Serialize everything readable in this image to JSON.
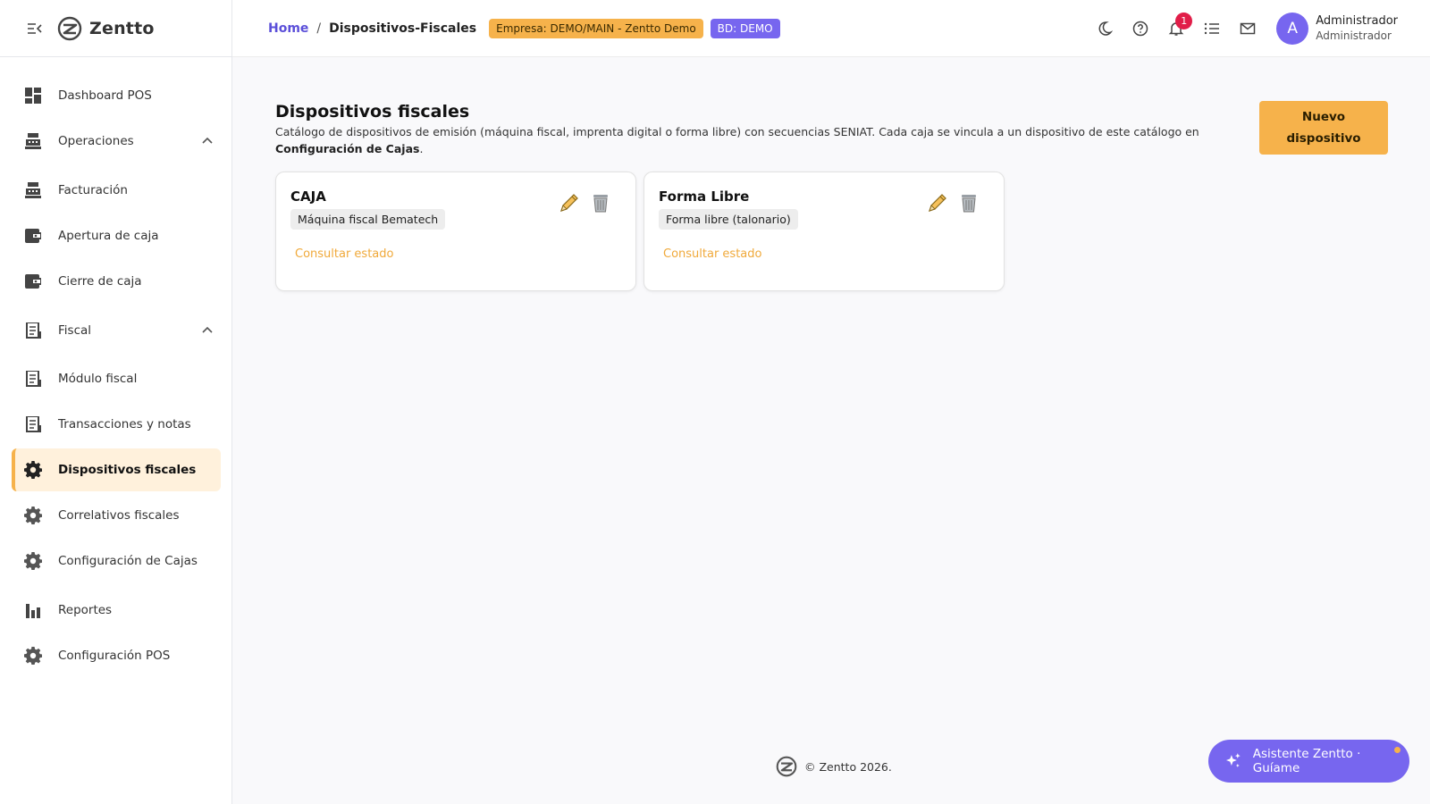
{
  "brand": {
    "name": "Zentto"
  },
  "sidebar": {
    "items": [
      {
        "label": "Dashboard POS",
        "icon": "dashboard-icon"
      },
      {
        "label": "Operaciones",
        "icon": "register-icon",
        "expanded": true
      },
      {
        "label": "Facturación",
        "icon": "register-icon"
      },
      {
        "label": "Apertura de caja",
        "icon": "wallet-icon"
      },
      {
        "label": "Cierre de caja",
        "icon": "wallet-icon"
      },
      {
        "label": "Fiscal",
        "icon": "receipt-icon",
        "expanded": true
      },
      {
        "label": "Módulo fiscal",
        "icon": "receipt-icon"
      },
      {
        "label": "Transacciones y notas",
        "icon": "receipt-icon"
      },
      {
        "label": "Dispositivos fiscales",
        "icon": "gear-icon",
        "active": true
      },
      {
        "label": "Correlativos fiscales",
        "icon": "gear-icon"
      },
      {
        "label": "Configuración de Cajas",
        "icon": "gear-icon"
      },
      {
        "label": "Reportes",
        "icon": "bar-chart-icon"
      },
      {
        "label": "Configuración POS",
        "icon": "gear-icon"
      }
    ]
  },
  "header": {
    "breadcrumb_home": "Home",
    "breadcrumb_sep": "/",
    "breadcrumb_current": "Dispositivos-Fiscales",
    "badge_company": "Empresa: DEMO/MAIN - Zentto Demo",
    "badge_db": "BD: DEMO",
    "notification_count": "1",
    "avatar_letter": "A",
    "user_name": "Administrador",
    "user_role": "Administrador"
  },
  "page": {
    "title": "Dispositivos fiscales",
    "description_prefix": "Catálogo de dispositivos de emisión (máquina fiscal, imprenta digital o forma libre) con secuencias SENIAT. Cada caja se vincula a un dispositivo de este catálogo en ",
    "description_bold": "Configuración de Cajas",
    "description_suffix": ".",
    "new_button_line1": "Nuevo",
    "new_button_line2": "dispositivo"
  },
  "devices": [
    {
      "name": "CAJA",
      "type": "Máquina fiscal Bematech",
      "action": "Consultar estado"
    },
    {
      "name": "Forma Libre",
      "type": "Forma libre (talonario)",
      "action": "Consultar estado"
    }
  ],
  "footer": {
    "text": "© Zentto 2026."
  },
  "assistant": {
    "label": "Asistente Zentto · Guíame"
  },
  "colors": {
    "accent_orange": "#f6b24b",
    "accent_purple": "#7766ef",
    "link_orange": "#f0a93a",
    "notification_red": "#e11d48"
  }
}
